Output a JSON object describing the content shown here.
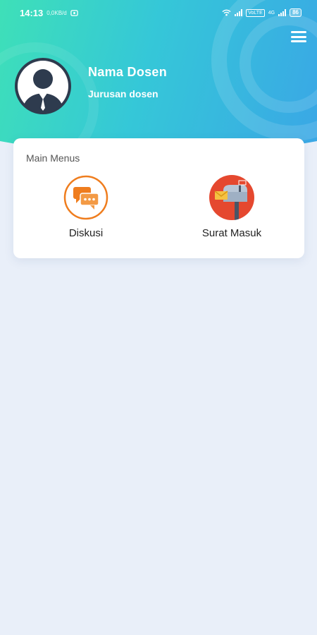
{
  "status_bar": {
    "time": "14:13",
    "net_speed": "0,0KB/d",
    "sim_badge": "VoLTE",
    "net_type": "4G",
    "battery": "86"
  },
  "profile": {
    "name": "Nama Dosen",
    "department": "Jurusan dosen"
  },
  "main_menu": {
    "title": "Main Menus",
    "items": [
      {
        "label": "Diskusi",
        "icon": "chat-bubbles-icon"
      },
      {
        "label": "Surat Masuk",
        "icon": "mailbox-icon"
      }
    ]
  },
  "colors": {
    "header_gradient_start": "#3ee0b8",
    "header_gradient_end": "#3aa6e6",
    "background": "#e9eff9",
    "diskusi_accent": "#ef7d1e",
    "surat_accent": "#e5482f"
  }
}
